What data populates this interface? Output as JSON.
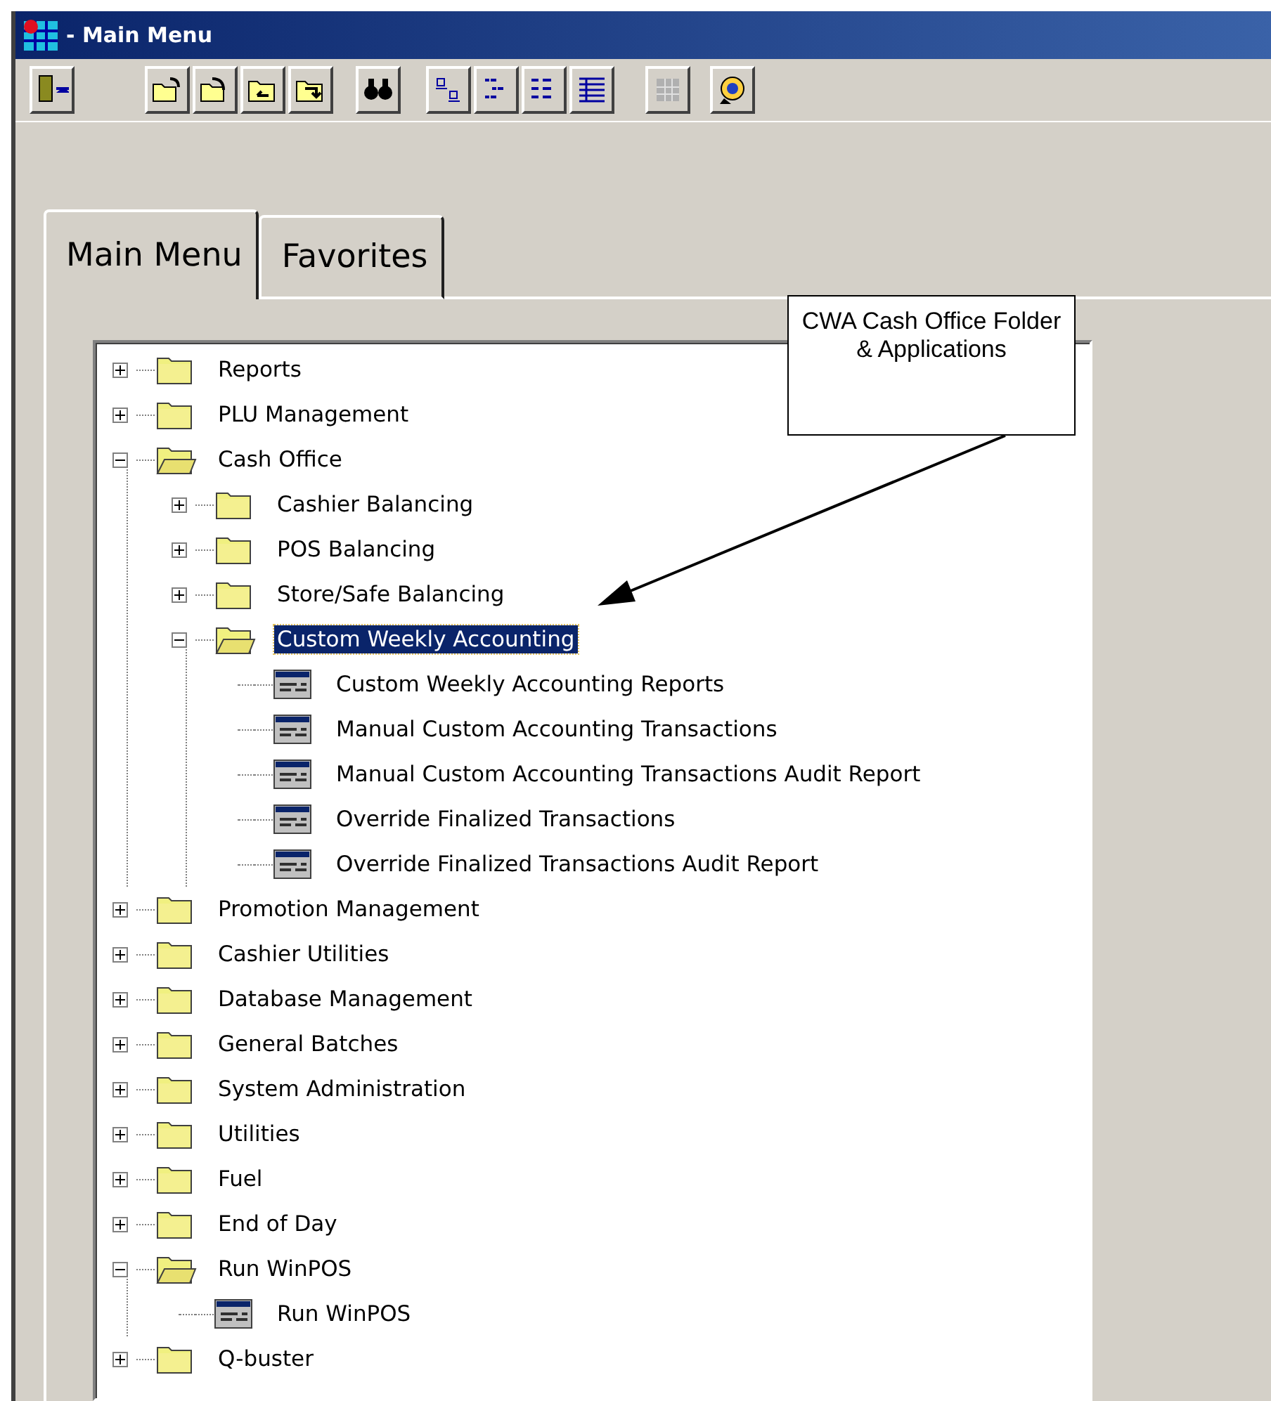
{
  "window": {
    "title": "- Main Menu"
  },
  "toolbar_buttons": [
    {
      "disabled": false
    },
    {
      "disabled": false
    },
    {
      "disabled": false
    },
    {
      "disabled": false
    },
    {
      "disabled": false
    },
    {
      "disabled": false
    },
    {
      "disabled": false
    },
    {
      "disabled": false
    },
    {
      "disabled": false
    },
    {
      "disabled": false
    },
    {
      "disabled": true
    },
    {
      "disabled": false
    }
  ],
  "tabs": [
    {
      "label": "Main Menu",
      "selected": true
    },
    {
      "label": "Favorites",
      "selected": false
    }
  ],
  "tree": [
    {
      "kind": "folder",
      "label": "Reports",
      "expanded": false,
      "selected": false
    },
    {
      "kind": "folder",
      "label": "PLU Management",
      "expanded": false,
      "selected": false
    },
    {
      "kind": "folder",
      "label": "Cash Office",
      "expanded": true,
      "selected": false,
      "children": [
        {
          "kind": "folder",
          "label": "Cashier Balancing",
          "expanded": false,
          "selected": false
        },
        {
          "kind": "folder",
          "label": "POS Balancing",
          "expanded": false,
          "selected": false
        },
        {
          "kind": "folder",
          "label": "Store/Safe Balancing",
          "expanded": false,
          "selected": false
        },
        {
          "kind": "folder",
          "label": "Custom Weekly Accounting",
          "expanded": true,
          "selected": true,
          "children": [
            {
              "kind": "app",
              "label": "Custom Weekly Accounting Reports",
              "selected": false
            },
            {
              "kind": "app",
              "label": "Manual Custom Accounting Transactions",
              "selected": false
            },
            {
              "kind": "app",
              "label": "Manual Custom Accounting Transactions Audit Report",
              "selected": false
            },
            {
              "kind": "app",
              "label": "Override Finalized Transactions",
              "selected": false
            },
            {
              "kind": "app",
              "label": "Override Finalized Transactions Audit Report",
              "selected": false
            }
          ]
        }
      ]
    },
    {
      "kind": "folder",
      "label": "Promotion Management",
      "expanded": false,
      "selected": false
    },
    {
      "kind": "folder",
      "label": "Cashier Utilities",
      "expanded": false,
      "selected": false
    },
    {
      "kind": "folder",
      "label": "Database Management",
      "expanded": false,
      "selected": false
    },
    {
      "kind": "folder",
      "label": "General Batches",
      "expanded": false,
      "selected": false
    },
    {
      "kind": "folder",
      "label": "System Administration",
      "expanded": false,
      "selected": false
    },
    {
      "kind": "folder",
      "label": "Utilities",
      "expanded": false,
      "selected": false
    },
    {
      "kind": "folder",
      "label": "Fuel",
      "expanded": false,
      "selected": false
    },
    {
      "kind": "folder",
      "label": "End of Day",
      "expanded": false,
      "selected": false
    },
    {
      "kind": "folder",
      "label": "Run WinPOS",
      "expanded": true,
      "selected": false,
      "children": [
        {
          "kind": "app",
          "label": "Run WinPOS",
          "selected": false
        }
      ]
    },
    {
      "kind": "folder",
      "label": "Q-buster",
      "expanded": false,
      "selected": false
    }
  ],
  "callout": {
    "text": "CWA Cash Office Folder\n& Applications"
  }
}
